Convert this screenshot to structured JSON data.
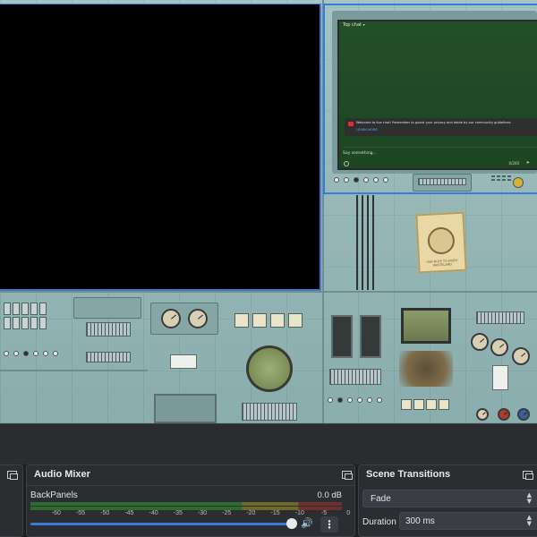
{
  "preview": {
    "chat": {
      "header": "Top chat",
      "header_chevron": "▾",
      "notice_text": "Welcome to live chat! Remember to guard your privacy and abide by our community guidelines.",
      "learn_more": "LEARN MORE",
      "input_placeholder": "Say something...",
      "char_count": "0/200",
      "send_icon": "➤"
    },
    "poster_text": "VAN NUYS TO EVERY WASTELAND"
  },
  "audio_mixer": {
    "title": "Audio Mixer",
    "track": {
      "name": "BackPanels",
      "db": "0.0 dB"
    },
    "ticks": [
      "-60",
      "-55",
      "-50",
      "-45",
      "-40",
      "-35",
      "-30",
      "-25",
      "-20",
      "-15",
      "-10",
      "-5",
      "0"
    ],
    "volume_fraction": 1.0,
    "mute_icon": "🔊",
    "menu_icon": "⋮"
  },
  "scene_transitions": {
    "title": "Scene Transitions",
    "selected": "Fade",
    "duration_label": "Duration",
    "duration_value": "300 ms"
  },
  "colors": {
    "accent": "#3b7bd7",
    "panel_bg": "#2b2d31",
    "meter_green": "#2e6b2e",
    "meter_yellow": "#6e6a2a",
    "meter_red": "#6e2f2f"
  }
}
